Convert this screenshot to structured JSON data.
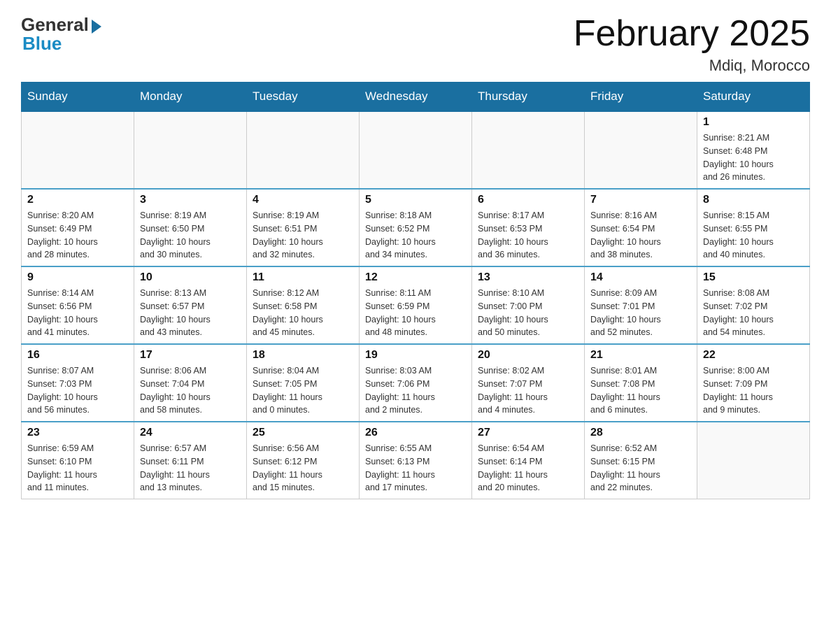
{
  "header": {
    "logo_general": "General",
    "logo_blue": "Blue",
    "title": "February 2025",
    "location": "Mdiq, Morocco"
  },
  "days_of_week": [
    "Sunday",
    "Monday",
    "Tuesday",
    "Wednesday",
    "Thursday",
    "Friday",
    "Saturday"
  ],
  "weeks": [
    [
      {
        "day": "",
        "info": ""
      },
      {
        "day": "",
        "info": ""
      },
      {
        "day": "",
        "info": ""
      },
      {
        "day": "",
        "info": ""
      },
      {
        "day": "",
        "info": ""
      },
      {
        "day": "",
        "info": ""
      },
      {
        "day": "1",
        "info": "Sunrise: 8:21 AM\nSunset: 6:48 PM\nDaylight: 10 hours\nand 26 minutes."
      }
    ],
    [
      {
        "day": "2",
        "info": "Sunrise: 8:20 AM\nSunset: 6:49 PM\nDaylight: 10 hours\nand 28 minutes."
      },
      {
        "day": "3",
        "info": "Sunrise: 8:19 AM\nSunset: 6:50 PM\nDaylight: 10 hours\nand 30 minutes."
      },
      {
        "day": "4",
        "info": "Sunrise: 8:19 AM\nSunset: 6:51 PM\nDaylight: 10 hours\nand 32 minutes."
      },
      {
        "day": "5",
        "info": "Sunrise: 8:18 AM\nSunset: 6:52 PM\nDaylight: 10 hours\nand 34 minutes."
      },
      {
        "day": "6",
        "info": "Sunrise: 8:17 AM\nSunset: 6:53 PM\nDaylight: 10 hours\nand 36 minutes."
      },
      {
        "day": "7",
        "info": "Sunrise: 8:16 AM\nSunset: 6:54 PM\nDaylight: 10 hours\nand 38 minutes."
      },
      {
        "day": "8",
        "info": "Sunrise: 8:15 AM\nSunset: 6:55 PM\nDaylight: 10 hours\nand 40 minutes."
      }
    ],
    [
      {
        "day": "9",
        "info": "Sunrise: 8:14 AM\nSunset: 6:56 PM\nDaylight: 10 hours\nand 41 minutes."
      },
      {
        "day": "10",
        "info": "Sunrise: 8:13 AM\nSunset: 6:57 PM\nDaylight: 10 hours\nand 43 minutes."
      },
      {
        "day": "11",
        "info": "Sunrise: 8:12 AM\nSunset: 6:58 PM\nDaylight: 10 hours\nand 45 minutes."
      },
      {
        "day": "12",
        "info": "Sunrise: 8:11 AM\nSunset: 6:59 PM\nDaylight: 10 hours\nand 48 minutes."
      },
      {
        "day": "13",
        "info": "Sunrise: 8:10 AM\nSunset: 7:00 PM\nDaylight: 10 hours\nand 50 minutes."
      },
      {
        "day": "14",
        "info": "Sunrise: 8:09 AM\nSunset: 7:01 PM\nDaylight: 10 hours\nand 52 minutes."
      },
      {
        "day": "15",
        "info": "Sunrise: 8:08 AM\nSunset: 7:02 PM\nDaylight: 10 hours\nand 54 minutes."
      }
    ],
    [
      {
        "day": "16",
        "info": "Sunrise: 8:07 AM\nSunset: 7:03 PM\nDaylight: 10 hours\nand 56 minutes."
      },
      {
        "day": "17",
        "info": "Sunrise: 8:06 AM\nSunset: 7:04 PM\nDaylight: 10 hours\nand 58 minutes."
      },
      {
        "day": "18",
        "info": "Sunrise: 8:04 AM\nSunset: 7:05 PM\nDaylight: 11 hours\nand 0 minutes."
      },
      {
        "day": "19",
        "info": "Sunrise: 8:03 AM\nSunset: 7:06 PM\nDaylight: 11 hours\nand 2 minutes."
      },
      {
        "day": "20",
        "info": "Sunrise: 8:02 AM\nSunset: 7:07 PM\nDaylight: 11 hours\nand 4 minutes."
      },
      {
        "day": "21",
        "info": "Sunrise: 8:01 AM\nSunset: 7:08 PM\nDaylight: 11 hours\nand 6 minutes."
      },
      {
        "day": "22",
        "info": "Sunrise: 8:00 AM\nSunset: 7:09 PM\nDaylight: 11 hours\nand 9 minutes."
      }
    ],
    [
      {
        "day": "23",
        "info": "Sunrise: 6:59 AM\nSunset: 6:10 PM\nDaylight: 11 hours\nand 11 minutes."
      },
      {
        "day": "24",
        "info": "Sunrise: 6:57 AM\nSunset: 6:11 PM\nDaylight: 11 hours\nand 13 minutes."
      },
      {
        "day": "25",
        "info": "Sunrise: 6:56 AM\nSunset: 6:12 PM\nDaylight: 11 hours\nand 15 minutes."
      },
      {
        "day": "26",
        "info": "Sunrise: 6:55 AM\nSunset: 6:13 PM\nDaylight: 11 hours\nand 17 minutes."
      },
      {
        "day": "27",
        "info": "Sunrise: 6:54 AM\nSunset: 6:14 PM\nDaylight: 11 hours\nand 20 minutes."
      },
      {
        "day": "28",
        "info": "Sunrise: 6:52 AM\nSunset: 6:15 PM\nDaylight: 11 hours\nand 22 minutes."
      },
      {
        "day": "",
        "info": ""
      }
    ]
  ]
}
